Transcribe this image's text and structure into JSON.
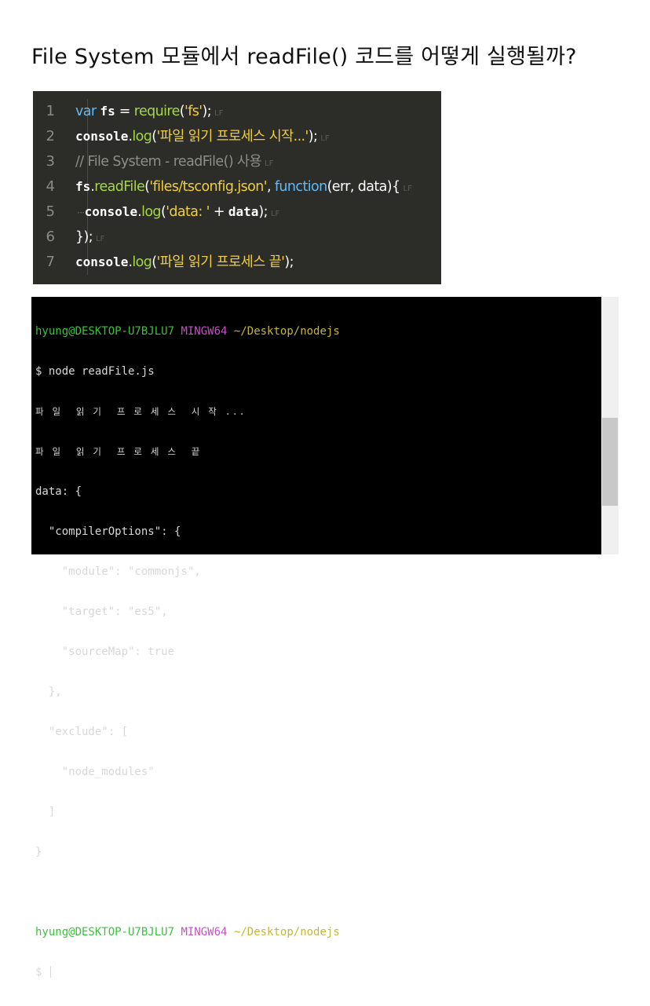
{
  "title": "File System 모듈에서 readFile() 코드를 어떻게 실행될까?",
  "editor": {
    "lf_marker": "LF",
    "whitespace_marker": "···",
    "lines": [
      {
        "num": "1",
        "tokens": [
          "var",
          "fs",
          "=",
          "require",
          "(",
          "'fs'",
          ");"
        ]
      },
      {
        "num": "2",
        "tokens": [
          "console",
          ".",
          "log",
          "(",
          "'파일 읽기 프로세스 시작...'",
          ");"
        ]
      },
      {
        "num": "3",
        "tokens": [
          "// File System - readFile() 사용"
        ]
      },
      {
        "num": "4",
        "tokens": [
          "fs",
          ".",
          "readFile",
          "(",
          "'files/tsconfig.json'",
          ", ",
          "function",
          "(err, data){"
        ]
      },
      {
        "num": "5",
        "tokens": [
          "console",
          ".",
          "log",
          "(",
          "'data: '",
          " + ",
          "data",
          ");"
        ]
      },
      {
        "num": "6",
        "tokens": [
          "});"
        ]
      },
      {
        "num": "7",
        "tokens": [
          "console",
          ".",
          "log",
          "(",
          "'파일 읽기 프로세스 끝'",
          ");"
        ]
      }
    ]
  },
  "terminal": {
    "prompt_user": "hyung@DESKTOP-U7BJLU7",
    "prompt_env": "MINGW64",
    "prompt_path": "~/Desktop/nodejs",
    "command": "$ node readFile.js",
    "output": [
      "파 일  읽 기  프 로 세 스  시 작 ...",
      "파 일  읽 기  프 로 세 스  끝",
      "data: {",
      "  \"compilerOptions\": {",
      "    \"module\": \"commonjs\",",
      "    \"target\": \"es5\",",
      "    \"sourceMap\": true",
      "  },",
      "  \"exclude\": [",
      "    \"node_modules\"",
      "  ]",
      "}"
    ],
    "final_prompt": "$ "
  },
  "colors": {
    "editor_bg": "#2c2d29",
    "keyword": "#66b9f0",
    "function": "#a5d64a",
    "string": "#f2ce3f",
    "comment": "#8d8e86",
    "terminal_bg": "#000000",
    "prompt_green": "#3fbf3f",
    "prompt_magenta": "#c94fc9",
    "prompt_yellow": "#c7b53b"
  }
}
